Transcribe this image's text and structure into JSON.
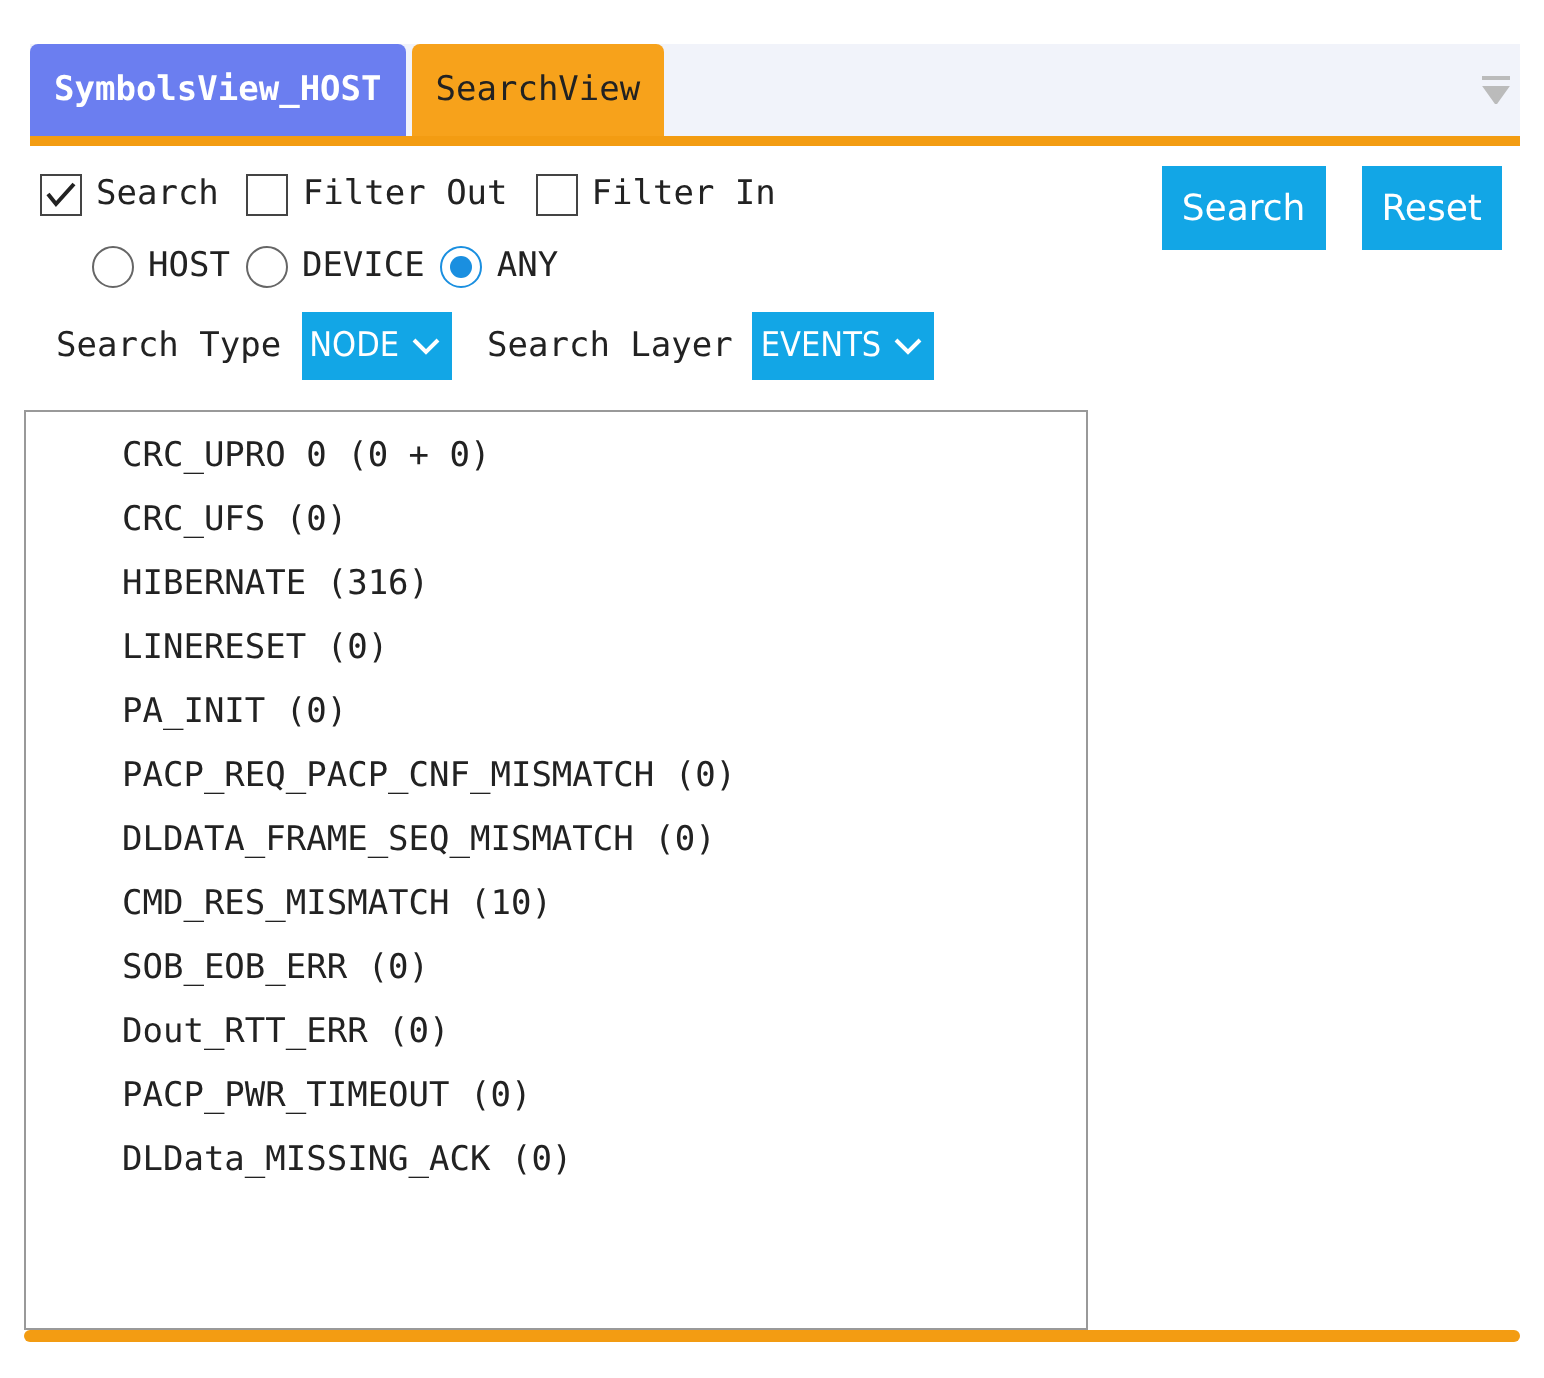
{
  "tabs": [
    {
      "label": "SymbolsView_HOST",
      "selected": false
    },
    {
      "label": "SearchView",
      "selected": true
    }
  ],
  "checkboxes": [
    {
      "label": "Search",
      "checked": true
    },
    {
      "label": "Filter Out",
      "checked": false
    },
    {
      "label": "Filter In",
      "checked": false
    }
  ],
  "radios": [
    {
      "label": "HOST",
      "selected": false
    },
    {
      "label": "DEVICE",
      "selected": false
    },
    {
      "label": "ANY",
      "selected": true
    }
  ],
  "buttons": [
    "Search",
    "Reset"
  ],
  "selects": [
    {
      "label": "Search Type",
      "value": "NODE"
    },
    {
      "label": "Search Layer",
      "value": "EVENTS"
    }
  ],
  "items": [
    "CRC_UPRO 0 (0 + 0)",
    "CRC_UFS (0)",
    "HIBERNATE (316)",
    "LINERESET (0)",
    "PA_INIT (0)",
    "PACP_REQ_PACP_CNF_MISMATCH (0)",
    "DLDATA_FRAME_SEQ_MISMATCH (0)",
    "CMD_RES_MISMATCH (10)",
    "SOB_EOB_ERR (0)",
    "Dout_RTT_ERR (0)",
    "PACP_PWR_TIMEOUT (0)",
    "DLData_MISSING_ACK (0)"
  ]
}
